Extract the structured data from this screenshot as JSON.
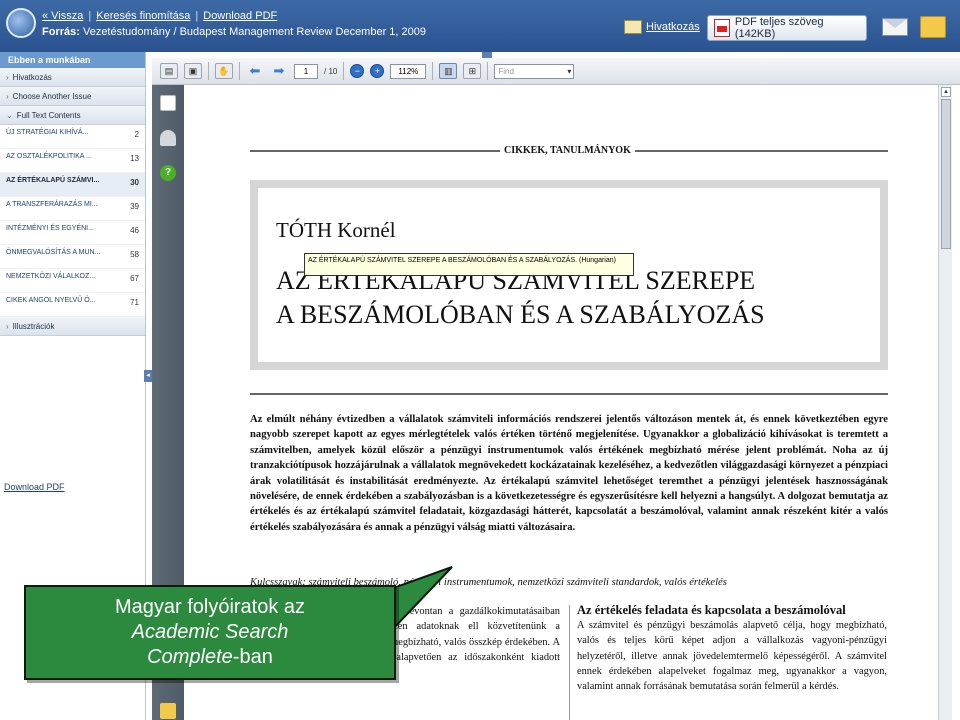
{
  "header": {
    "links": [
      "« Vissza",
      "Keresés finomítása",
      "Download PDF"
    ],
    "source_label": "Forrás:",
    "source_text": "Vezetéstudomány / Budapest Management Review December 1, 2009",
    "citations_label": "Hivatkozás",
    "pdf_button_label": "PDF teljes szöveg (142KB)"
  },
  "sidebar": {
    "heading": "Ebben a munkában",
    "sections": [
      "Hivatkozás",
      "Choose Another Issue",
      "Full Text Contents",
      "Illusztrációk"
    ],
    "toc": [
      {
        "label": "ÚJ STRATÉGIAI KIHÍVÁ...",
        "page": "2"
      },
      {
        "label": "AZ OSZTALÉKPOLITIKA ...",
        "page": "13"
      },
      {
        "label": "AZ ÉRTÉKALAPÚ SZÁMVI...",
        "page": "30"
      },
      {
        "label": "A TRANSZFERÁRAZÁS MI...",
        "page": "39"
      },
      {
        "label": "INTÉZMÉNYI ÉS EGYÉNI...",
        "page": "46"
      },
      {
        "label": "ÖNMEGVALÓSÍTÁS A MUN...",
        "page": "58"
      },
      {
        "label": "NEMZETKÖZI VÁLALKOZ...",
        "page": "67"
      },
      {
        "label": "CIKEK ANGOL NYELVŰ Ö...",
        "page": "71"
      }
    ],
    "download_pdf": "Download PDF"
  },
  "viewer": {
    "page_current": "1",
    "page_total": "/ 10",
    "zoom": "112%",
    "find_placeholder": "Find"
  },
  "document": {
    "kicker": "CIKKEK, TANULMÁNYOK",
    "author": "TÓTH Kornél",
    "title_line1": "AZ ÉRTÉKALAPÚ SZÁMVITEL SZEREPE",
    "title_line2": "A BESZÁMOLÓBAN ÉS A SZABÁLYOZÁS",
    "tooltip": "AZ ÉRTÉKALAPÚ SZÁMVITEL SZEREPE A BESZÁMOLÓBAN ÉS A SZABÁLYOZÁS. (Hungarian)",
    "abstract": "Az elmúlt néhány évtizedben a vállalatok számviteli információs rendszerei jelentős változáson mentek át, és ennek következtében egyre nagyobb szerepet kapott az egyes mérlegtételek valós értéken történő megjelenítése. Ugyanakkor a globalizáció kihívásokat is teremtett a számvitelben, amelyek közül először a pénzügyi instrumentumok valós értékének megbízható mérése jelent problémát. Noha az új tranzakciótípusok hozzájárulnak a vállalatok megnövekedett kockázatainak kezeléséhez, a kedvezőtlen világgazdasági környezet a pénzpiaci árak volatilitását és instabilitását eredményezte. Az értékalapú számvitel lehetőséget teremthet a pénzügyi jelentések hasznosságának növelésére, de ennek érdekében a szabályozásban is a következetességre és egyszerűsítésre kell helyezni a hangsúlyt. A dolgozat bemutatja az értékelés és az értékalapú számvitel feladatait, közgazdasági hátterét, kapcsolatát a beszámolóval, valamint annak részeként kitér a valós értékelés szabályozására és annak a pénzügyi válság miatti változásaira.",
    "keywords": "Kulcsszavak: számviteli beszámoló, pénzügyi instrumentumok, nemzetközi számviteli standardok, valós értékelés",
    "col_left": "rendszerei nagy mennyiségyek összevontan a gazdálkokimutatásaiban jelennek meg. környezetben ezen adatoknak ell közvetítenünk a jövedelmi, pénzügyi helyzetről a megbízható, valós összkép érdekében. A vállalati teljesítmény értékelése alapvetően az időszakonként kiadott pénzügyi jelentésekben alapul.",
    "col_right_heading": "Az értékelés feladata és kapcsolata a beszámolóval",
    "col_right": "A számvitel és pénzügyi beszámolás alapvető célja, hogy megbízható, valós és teljes körű képet adjon a vállalkozás vagyoni-pénzügyi helyzetéről, illetve annak jövedelemtermelő képességéről. A számvitel ennek érdekében alapelveket fogalmaz meg, ugyanakkor a vagyon, valamint annak forrásának bemutatása során felmerül a kérdés."
  },
  "callout": {
    "line1": "Magyar folyóiratok az",
    "line2": "Academic Search",
    "line3_italic": "Complete",
    "line3_rest": "-ban"
  }
}
